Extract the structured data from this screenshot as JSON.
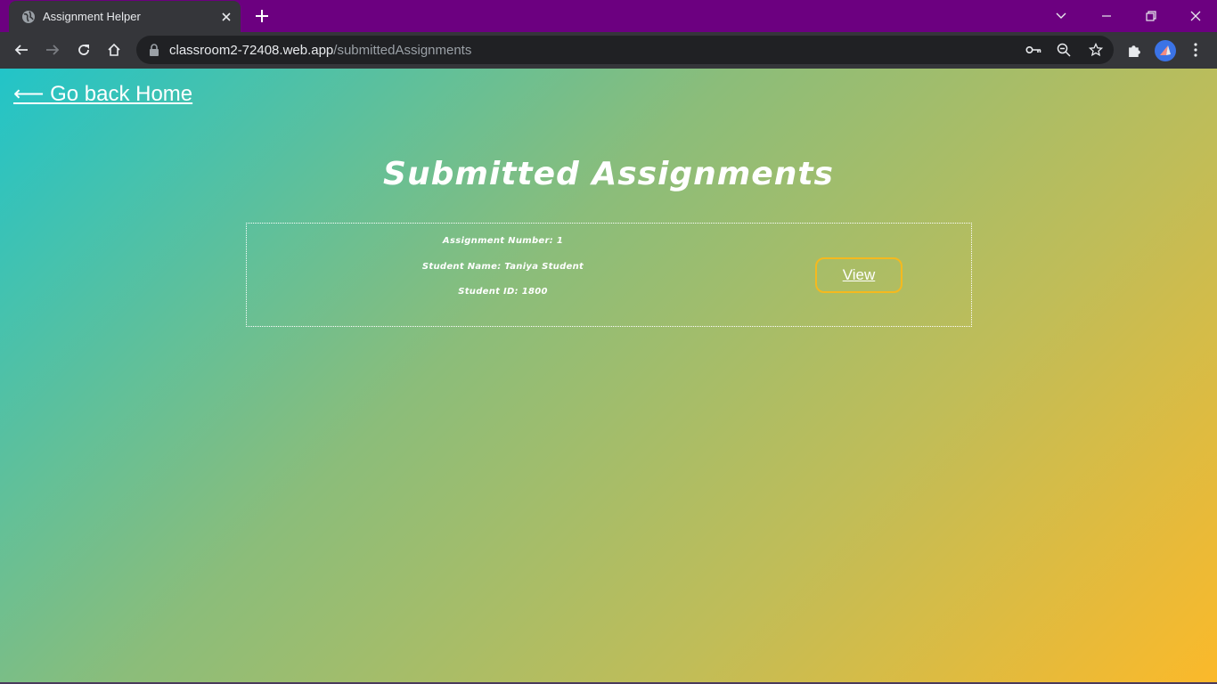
{
  "browser": {
    "tab_title": "Assignment Helper",
    "url_host": "classroom2-72408.web.app",
    "url_path": "/submittedAssignments"
  },
  "page": {
    "back_link": "⟵ Go back Home",
    "title": "Submitted Assignments",
    "assignments": [
      {
        "number_text": "Assignment Number: 1",
        "student_name_text": "Student Name: Taniya Student",
        "student_id_text": "Student ID: 1800",
        "view_label": "View"
      }
    ]
  },
  "colors": {
    "titlebar": "#6c0080",
    "gradient_start": "#22c4c8",
    "gradient_end": "#fbb92a",
    "view_border": "#f5b91e"
  }
}
